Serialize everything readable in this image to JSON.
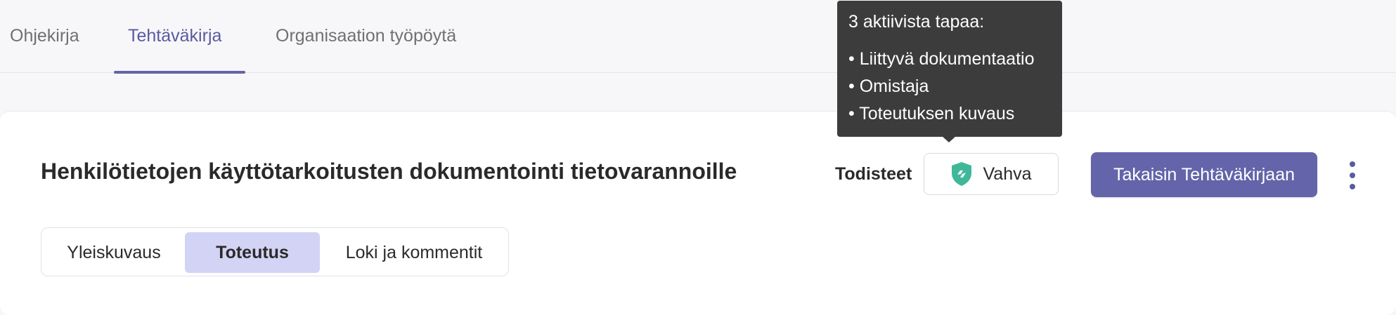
{
  "top_nav": {
    "tabs": [
      {
        "label": "Ohjekirja",
        "active": false
      },
      {
        "label": "Tehtäväkirja",
        "active": true
      },
      {
        "label": "Organisaation työpöytä",
        "active": false
      }
    ]
  },
  "header": {
    "title": "Henkilötietojen käyttötarkoitusten dokumentointi tietovarannoille",
    "evidence_label": "Todisteet",
    "evidence_value": "Vahva",
    "evidence_icon": "shield-icon",
    "back_button_label": "Takaisin Tehtäväkirjaan",
    "menu_icon": "kebab-menu-icon"
  },
  "sub_tabs": [
    {
      "label": "Yleiskuvaus",
      "active": false
    },
    {
      "label": "Toteutus",
      "active": true
    },
    {
      "label": "Loki ja kommentit",
      "active": false
    }
  ],
  "tooltip": {
    "heading": "3 aktiivista tapaa:",
    "items": [
      "Liittyvä dokumentaatio",
      "Omistaja",
      "Toteutuksen kuvaus"
    ],
    "bullet": "•"
  },
  "colors": {
    "accent": "#6464aa",
    "active_subtab": "#d3d3f5",
    "shield": "#3fb89a",
    "tooltip_bg": "#3c3c3c"
  }
}
